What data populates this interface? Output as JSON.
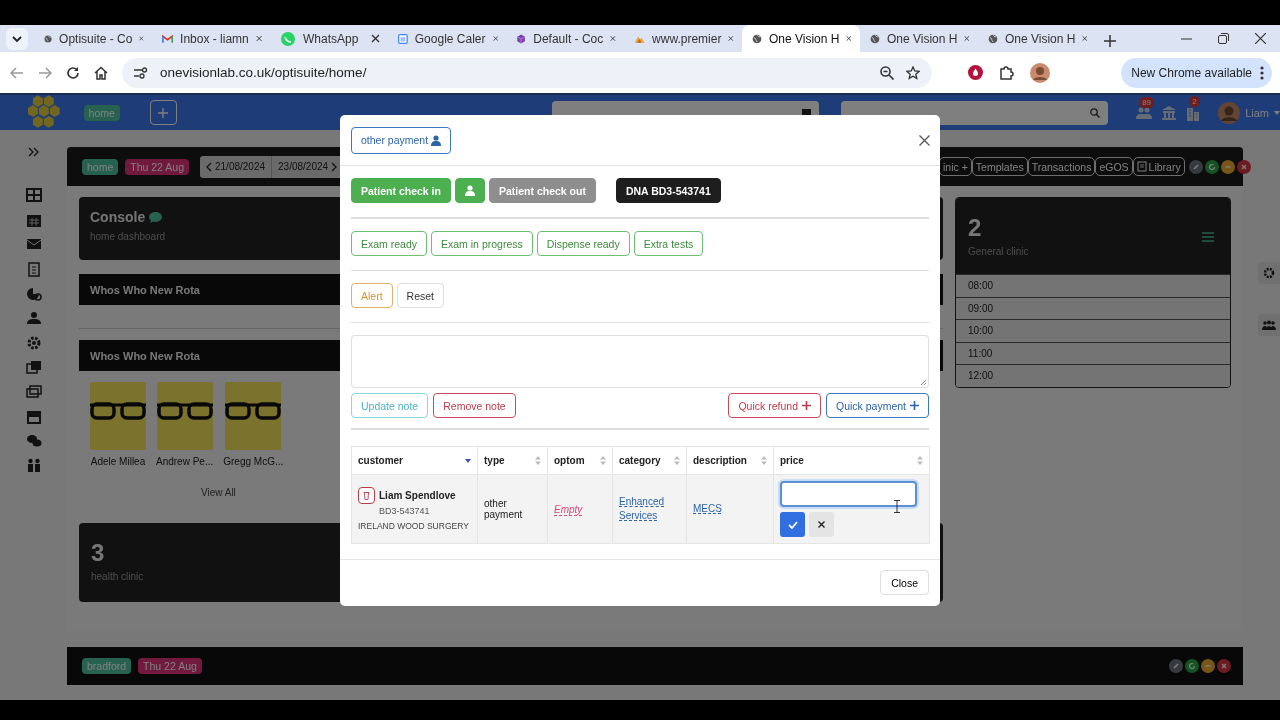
{
  "browser": {
    "tabs": [
      {
        "title": "Optisuite - Co",
        "kind": "globe",
        "selected": false
      },
      {
        "title": "Inbox - liamn",
        "kind": "mail",
        "selected": false
      },
      {
        "title": "WhatsApp",
        "kind": "chat",
        "selected": false
      },
      {
        "title": "Google Caler",
        "kind": "calendar",
        "selected": false
      },
      {
        "title": "Default - Coc",
        "kind": "cube",
        "selected": false
      },
      {
        "title": "www.premier",
        "kind": "logo",
        "selected": false
      },
      {
        "title": "One Vision H",
        "kind": "globe",
        "selected": true
      },
      {
        "title": "One Vision H",
        "kind": "globe",
        "selected": false
      },
      {
        "title": "One Vision H",
        "kind": "globe",
        "selected": false
      }
    ],
    "url": "onevisionlab.co.uk/optisuite/home/",
    "update": "New Chrome available"
  },
  "header": {
    "badge": "home",
    "alerts": [
      {
        "kind": "people",
        "count": "89"
      },
      {
        "kind": "bank"
      },
      {
        "kind": "building",
        "count": "2"
      }
    ],
    "user": "Liam"
  },
  "panel": {
    "location": "home",
    "day": "Thu 22 Aug",
    "prev_date": "21/08/2024",
    "next_date": "23/08/2024",
    "actions": [
      {
        "label": "inic +",
        "kind": "plain"
      },
      {
        "label": "Templates",
        "kind": "plain"
      },
      {
        "label": "Transactions",
        "kind": "plain"
      },
      {
        "label": "eGOS",
        "kind": "plain"
      },
      {
        "label": "Library",
        "kind": "book"
      }
    ],
    "controls": [
      {
        "kind": "link"
      },
      {
        "kind": "refresh"
      },
      {
        "kind": "minimize"
      },
      {
        "kind": "close"
      }
    ]
  },
  "console": {
    "title": "Console",
    "subtitle": "home dashboard"
  },
  "rotas": [
    {
      "title": "Whos Who New Rota"
    },
    {
      "title": "Whos Who New Rota",
      "people": [
        {
          "name": "Adele Millea"
        },
        {
          "name": "Andrew Pe..."
        },
        {
          "name": "Gregg McG..."
        }
      ],
      "link": "View All"
    }
  ],
  "clinic_cards": [
    {
      "number": "3",
      "name": "health clinic"
    },
    {
      "number": "2",
      "name": "General clinic",
      "slots": [
        "08:00",
        "09:00",
        "10:00",
        "11:00",
        "12:00"
      ]
    }
  ],
  "next_panel": {
    "location": "bradford",
    "day": "Thu 22 Aug",
    "controls": [
      {
        "kind": "link"
      },
      {
        "kind": "refresh"
      },
      {
        "kind": "minimize"
      },
      {
        "kind": "close"
      }
    ]
  },
  "modal": {
    "payment_chip": "other payment",
    "status_buttons": [
      {
        "label": "Patient check in",
        "kind": "success"
      },
      {
        "kind": "success-icon"
      },
      {
        "label": "Patient check out",
        "kind": "muted"
      },
      {
        "label": "DNA BD3-543741",
        "kind": "dark"
      }
    ],
    "stage_buttons": [
      {
        "label": "Exam ready"
      },
      {
        "label": "Exam in progress"
      },
      {
        "label": "Dispense ready"
      },
      {
        "label": "Extra tests"
      }
    ],
    "alert_buttons": [
      {
        "label": "Alert",
        "kind": "warning"
      },
      {
        "label": "Reset",
        "kind": "plain"
      }
    ],
    "note_buttons": [
      {
        "label": "Update note",
        "kind": "info"
      },
      {
        "label": "Remove note",
        "kind": "danger"
      }
    ],
    "payment_buttons": [
      {
        "label": "Quick refund",
        "kind": "danger"
      },
      {
        "label": "Quick payment",
        "kind": "primary"
      }
    ],
    "table": {
      "columns": [
        {
          "label": "customer",
          "sorted": true
        },
        {
          "label": "type",
          "sorted": false
        },
        {
          "label": "optom",
          "sorted": false
        },
        {
          "label": "category",
          "sorted": false
        },
        {
          "label": "description",
          "sorted": false
        },
        {
          "label": "price",
          "sorted": false
        }
      ],
      "rows": [
        {
          "customer": "**Liam Spendlove** BD3-543741",
          "practice": "IRELAND WOOD SURGERY",
          "type": "other payment",
          "optom": "Empty",
          "category": "Enhanced Services",
          "description": "MECS"
        }
      ]
    },
    "close": "Close"
  }
}
